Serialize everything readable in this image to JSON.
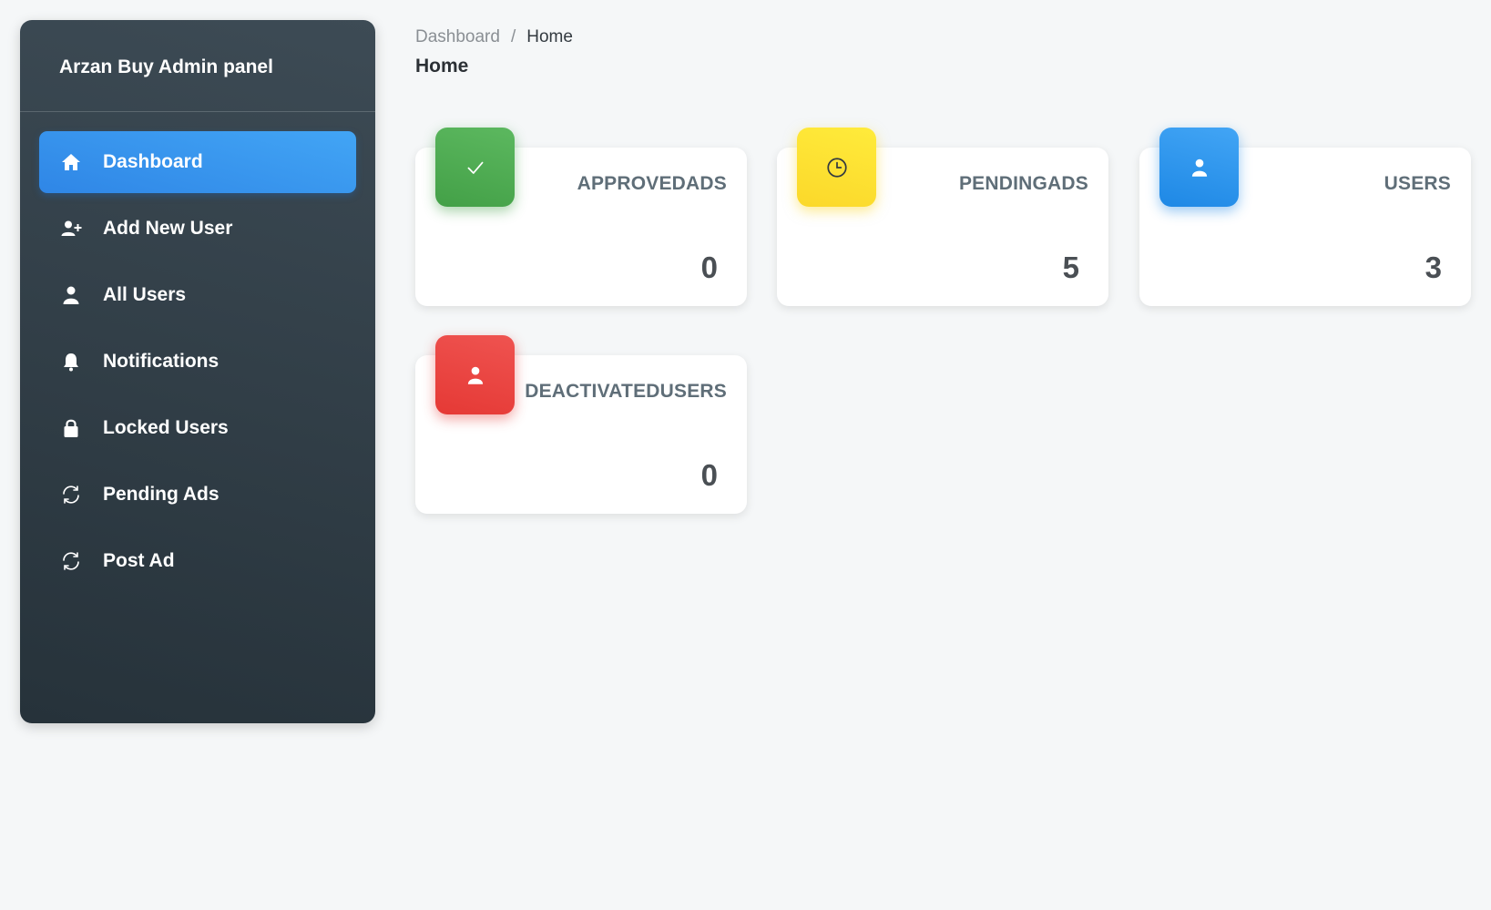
{
  "sidebar": {
    "brand": "Arzan Buy Admin panel",
    "items": [
      {
        "label": "Dashboard",
        "icon": "home-icon",
        "active": true
      },
      {
        "label": "Add New User",
        "icon": "add-user-icon"
      },
      {
        "label": "All Users",
        "icon": "user-icon"
      },
      {
        "label": "Notifications",
        "icon": "bell-icon"
      },
      {
        "label": "Locked Users",
        "icon": "lock-icon"
      },
      {
        "label": "Pending Ads",
        "icon": "refresh-icon"
      },
      {
        "label": "Post Ad",
        "icon": "refresh-icon"
      }
    ]
  },
  "breadcrumb": {
    "parent": "Dashboard",
    "separator": "/",
    "current": "Home"
  },
  "page_title": "Home",
  "cards": [
    {
      "label": "APPROVEDADS",
      "value": "0",
      "icon": "check-icon",
      "color": "#4caf50"
    },
    {
      "label": "PENDINGADS",
      "value": "5",
      "icon": "clock-icon",
      "color": "#fdd835"
    },
    {
      "label": "USERS",
      "value": "3",
      "icon": "user-icon",
      "color": "#2196f3"
    },
    {
      "label": "DEACTIVATEDUSERS",
      "value": "0",
      "icon": "user-icon",
      "color": "#e53935"
    }
  ],
  "colors": {
    "sidebar_bg": "#2f3c45",
    "active_item": "#3c91e6",
    "page_bg": "#f5f7f8"
  }
}
